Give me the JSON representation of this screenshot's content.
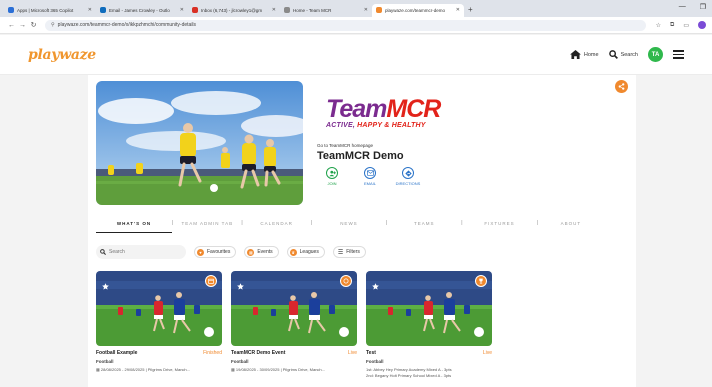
{
  "browser": {
    "tabs": [
      {
        "title": "Apps | Microsoft 365 Copilot",
        "color": "#2b6fd6"
      },
      {
        "title": "Email - James Crowley - Outlo",
        "color": "#0f6cbd"
      },
      {
        "title": "Inbox (6,743) - jlcrowley1@gm",
        "color": "#d93025"
      },
      {
        "title": "Home - Team MCR",
        "color": "#8a8a8a"
      },
      {
        "title": "playwaze.com/teammcr-demo",
        "color": "#f0892e"
      }
    ],
    "active_tab": 4,
    "new_tab": "+",
    "url": "playwaze.com/teammcr-demo/x/ikkpzhmchi/community-details"
  },
  "site": {
    "logo": "playwaze",
    "home_label": "Home",
    "search_label": "Search",
    "avatar_initials": "TA"
  },
  "community": {
    "logo_main_a": "Team",
    "logo_main_b": "MCR",
    "logo_tagline_a": "ACTIVE, ",
    "logo_tagline_b": "HAPPY & HEALTHY",
    "goto_text": "Go to TeamMCR homepage",
    "name": "TeamMCR Demo",
    "actions": [
      {
        "label": "JOIN",
        "icon": "add-user-icon"
      },
      {
        "label": "EMAIL",
        "icon": "email-icon"
      },
      {
        "label": "DIRECTIONS",
        "icon": "directions-icon"
      }
    ]
  },
  "nav_tabs": [
    "WHAT'S ON",
    "TEAM ADMIN TAB",
    "CALENDAR",
    "NEWS",
    "TEAMS",
    "FIXTURES",
    "ABOUT"
  ],
  "nav_separator": "|",
  "filters": {
    "search_placeholder": "Search",
    "favourites": "Favourites",
    "events": "Events",
    "leagues": "Leagues",
    "filters": "Filters"
  },
  "events": [
    {
      "title": "Football Example",
      "status": "Finished",
      "sport": "Football",
      "meta": "28/08/2025 - 29/08/2025 | Pilgrims Drive, Manch...",
      "meta2": ""
    },
    {
      "title": "TeamMCR Demo Event",
      "status": "Live",
      "sport": "Football",
      "meta": "19/08/2025 - 30/09/2025 | Pilgrims Drive, Manch...",
      "meta2": ""
    },
    {
      "title": "Test",
      "status": "Live",
      "sport": "Football",
      "meta": "1st: Abbey Hey Primary Academy Mixed A - 3pts",
      "meta2": "2nd: Begany Holt Primary School Mixed A - 3pts"
    }
  ],
  "colors": {
    "brand_orange": "#f0892e",
    "link_blue": "#2a73c8",
    "join_green": "#1fa24a",
    "team_purple": "#7b2b8f",
    "team_red": "#e2231a"
  }
}
